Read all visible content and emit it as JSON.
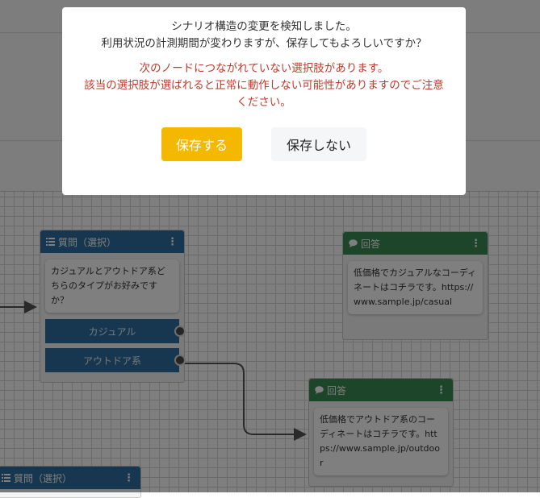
{
  "dialog": {
    "message_line1": "シナリオ構造の変更を検知しました。",
    "message_line2": "利用状況の計測期間が変わりますが、保存してもよろしいですか？",
    "warning_line1": "次のノードにつながれていない選択肢があります。",
    "warning_line2": "該当の選択肢が選ばれると正常に動作しない可能性がありますのでご注意",
    "warning_line3": "ください。",
    "save_label": "保存する",
    "dont_save_label": "保存しない",
    "warning_color": "#c0392b",
    "primary_color": "#f5b800"
  },
  "nodes": {
    "question1": {
      "title": "質問（選択）",
      "menu": "⋮",
      "text": "カジュアルとアウトドア系どちらのタイプがお好みですか？",
      "choices": [
        "カジュアル",
        "アウトドア系"
      ],
      "icon": "list-icon"
    },
    "answer1": {
      "title": "回答",
      "menu": "⋮",
      "text": "低価格でカジュアルなコーディネートはコチラです。https://www.sample.jp/casual",
      "icon": "speech-bubble-icon"
    },
    "answer2": {
      "title": "回答",
      "menu": "⋮",
      "text": "低価格でアウトドア系のコーディネートはコチラです。https://www.sample.jp/outdoor",
      "icon": "speech-bubble-icon"
    },
    "question2": {
      "title": "質問（選択）",
      "menu": "⋮",
      "icon": "list-icon"
    }
  },
  "colors": {
    "question_header": "#2c6f9f",
    "answer_header": "#3b8a55"
  }
}
